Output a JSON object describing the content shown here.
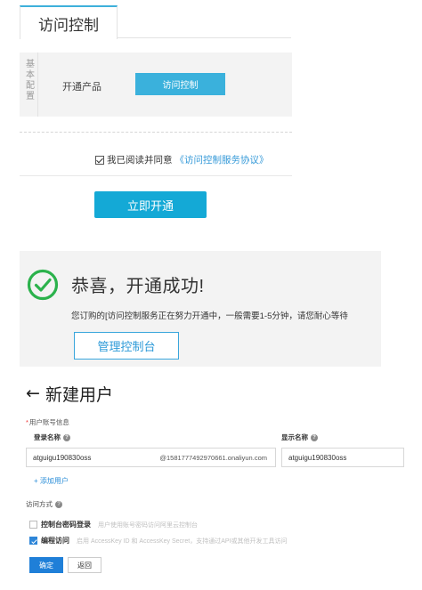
{
  "activation": {
    "tab_label": "访问控制",
    "side_label": "基本配置",
    "product_label": "开通产品",
    "product_value": "访问控制",
    "agree_text": "我已阅读并同意",
    "agree_link": "《访问控制服务协议》",
    "open_button": "立即开通"
  },
  "success": {
    "title": "恭喜，开通成功!",
    "message": "您订购的[访问控制服务正在努力开通中，一般需要1-5分钟，请您耐心等待",
    "console_button": "管理控制台"
  },
  "new_user": {
    "back_icon": "←",
    "title": "新建用户",
    "section_label": "用户账号信息",
    "login_name_label": "登录名称",
    "display_name_label": "显示名称",
    "login_name_value": "atguigu190830oss",
    "login_domain": "@1581777492970661.onaliyun.com",
    "display_name_value": "atguigu190830oss",
    "add_user": "+ 添加用户",
    "access_label": "访问方式",
    "console_access": {
      "label": "控制台密码登录",
      "desc": "用户使用账号密码访问阿里云控制台",
      "checked": false
    },
    "programmatic_access": {
      "label": "编程访问",
      "desc": "启用 AccessKey ID 和 AccessKey Secret，支持通过API或其他开发工具访问",
      "checked": true
    },
    "confirm_button": "确定",
    "back_button": "返回"
  }
}
